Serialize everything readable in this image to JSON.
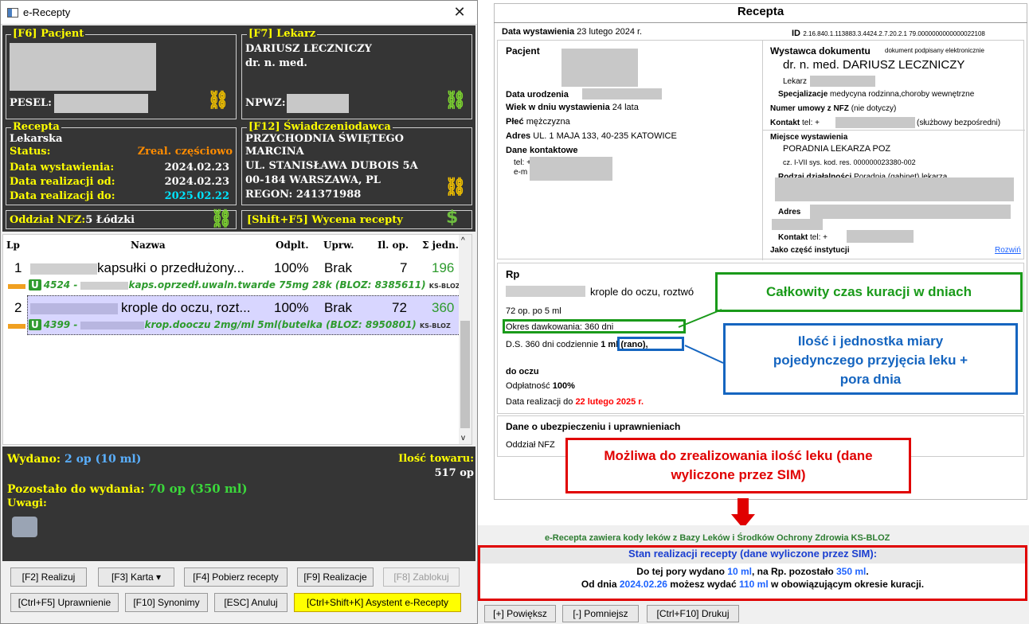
{
  "window": {
    "title": "e-Recepty",
    "close": "✕"
  },
  "patient": {
    "legend": "[F6] Pacjent",
    "pesel_label": "PESEL:"
  },
  "doctor": {
    "legend": "[F7] Lekarz",
    "name": "DARIUSZ LECZNICZY",
    "title": "dr. n. med.",
    "npwz_label": "NPWZ:"
  },
  "recepta": {
    "legend": "Recepta",
    "type": "Lekarska",
    "status_label": "Status:",
    "status_value": "Zreal. częściowo",
    "issued_label": "Data wystawienia:",
    "issued_value": "2024.02.23",
    "from_label": "Data realizacji od:",
    "from_value": "2024.02.23",
    "to_label": "Data realizacji do:",
    "to_value": "2025.02.22"
  },
  "provider": {
    "legend": "[F12] Świadczeniodawca",
    "line1": "PRZYCHODNIA ŚWIĘTEGO",
    "line2": "MARCINA",
    "line3": "UL. STANISŁAWA DUBOIS 5A",
    "line4": "00-184 WARSZAWA, PL",
    "regon": "REGON: 241371988"
  },
  "nfz": {
    "label": "Oddział NFZ:",
    "value": "5 Łódzki",
    "pricing": "[Shift+F5] Wycena recepty"
  },
  "table": {
    "headers": [
      "Lp",
      "Nazwa",
      "Odplt.",
      "Uprw.",
      "Il. op.",
      "Σ jedn."
    ],
    "rows": [
      {
        "lp": "1",
        "name": "kapsułki o przedłużony...",
        "refund": "100%",
        "entitlement": "Brak",
        "qty": "7",
        "units": "196",
        "sub": "4524 - ",
        "sub2": "kaps.oprzedł.uwaln.twarde 75mg 28k (BLOZ: 8385611)",
        "badge": "U",
        "bloz": "KS-BLOZ"
      },
      {
        "lp": "2",
        "name": "krople do oczu, rozt...",
        "refund": "100%",
        "entitlement": "Brak",
        "qty": "72",
        "units": "360",
        "sub": "4399 - ",
        "sub2": "krop.dooczu 2mg/ml 5ml(butelka (BLOZ: 8950801)",
        "badge": "U",
        "bloz": "KS-BLOZ"
      }
    ]
  },
  "summary": {
    "issued_label": "Wydano: ",
    "issued_value": "2 op (10 ml)",
    "stock_label": "Ilość towaru:",
    "stock_value": "517 op",
    "remaining_label": "Pozostało do wydania: ",
    "remaining_value": "70 op (350 ml)",
    "notes_label": "Uwagi:"
  },
  "buttons": {
    "realize": "[F2] Realizuj",
    "card": "[F3] Karta ▾",
    "fetch": "[F4] Pobierz recepty",
    "realizations": "[F9] Realizacje",
    "block": "[F8] Zablokuj",
    "entitlement": "[Ctrl+F5] Uprawnienie",
    "synonyms": "[F10] Synonimy",
    "cancel": "[ESC] Anuluj",
    "assistant": "[Ctrl+Shift+K] Asystent e-Recepty"
  },
  "doc": {
    "title": "Recepta",
    "issued_label": "Data wystawienia",
    "issued_value": "23 lutego 2024 r.",
    "id_label": "ID",
    "id_value": "2.16.840.1.113883.3.4424.2.7.20.2.1 79.0000000000000022108",
    "patient_title": "Pacjent",
    "birth_label": "Data urodzenia",
    "age_label": "Wiek w dniu wystawienia",
    "age_value": "24 lata",
    "sex_label": "Płeć",
    "sex_value": "mężczyzna",
    "address_label": "Adres",
    "address_value": "UL. 1 MAJA 133, 40-235 KATOWICE",
    "contact_label": "Dane kontaktowe",
    "tel": "tel: +",
    "email": "e-m",
    "issuer_title": "Wystawca dokumentu",
    "signed": "dokument podpisany elektronicznie",
    "issuer_name": "dr. n. med. DARIUSZ LECZNICZY",
    "lekarz": "Lekarz",
    "spec_label": "Specjalizacje",
    "spec_value": "medycyna rodzinna,choroby wewnętrzne",
    "contract_label": "Numer umowy z NFZ",
    "contract_value": "(nie dotyczy)",
    "contact_tel_label": "Kontakt",
    "contact_tel": "tel: +",
    "contact_tel_note": "(służbowy bezpośredni)",
    "place_title": "Miejsce wystawienia",
    "place_name": "PORADNIA LEKARZA POZ",
    "place_code": "cz. I-VII sys. kod. res. 000000023380-002",
    "activity_label": "Rodzaj działalności",
    "activity_value": "Poradnia (gabinet) lekarza",
    "addr2_label": "Adres",
    "contact2_label": "Kontakt",
    "contact2_tel": "tel: +",
    "institution": "Jako część instytucji",
    "expand": "Rozwiń",
    "rp_title": "Rp",
    "rp_name": "krople do oczu, roztwó",
    "packs": "72 op. po 5 ml",
    "period": "Okres dawkowania: 360 dni",
    "ds_prefix": "D.S. 360 dni codziennie ",
    "ds_dose": "1 ml (rano),",
    "route": "do oczu",
    "refund_label": "Odpłatność",
    "refund_value": "100%",
    "realize_label": "Data realizacji do",
    "realize_value": "22 lutego 2025 r.",
    "insurance_title": "Dane o ubezpieczeniu i uprawnieniach",
    "nfz_branch": "Oddział NFZ",
    "kodes": "e-Recepta zawiera kody leków z Bazy Leków i Środków Ochrony Zdrowia KS-BLOZ",
    "state_title": "Stan realizacji recepty (dane wyliczone przez SIM):",
    "state_l1a": "Do tej pory wydano ",
    "state_l1b": "10 ml",
    "state_l1c": ", na Rp. pozostało ",
    "state_l1d": "350 ml",
    "state_l1e": ".",
    "state_l2a": "Od dnia ",
    "state_l2b": "2024.02.26",
    "state_l2c": " możesz wydać ",
    "state_l2d": "110 ml",
    "state_l2e": " w obowiązującym okresie kuracji."
  },
  "callouts": {
    "green": "Całkowity czas kuracji w dniach",
    "blue": "Ilość i jednostka miary pojedynczego przyjęcia leku + pora dnia",
    "red": "Możliwa do zrealizowania ilość leku (dane wyliczone przez SIM)"
  },
  "bottom_buttons": {
    "zoom_in": "[+] Powiększ",
    "zoom_out": "[-] Pomniejsz",
    "print": "[Ctrl+F10] Drukuj"
  },
  "colors": {
    "dark_panel": "#353535",
    "legend_yellow": "#ffff00",
    "status_orange": "#ff8c00",
    "green": "#2e9b2e",
    "callout_green": "#1a9a1a",
    "callout_blue": "#1565c0",
    "callout_red": "#e00000"
  }
}
